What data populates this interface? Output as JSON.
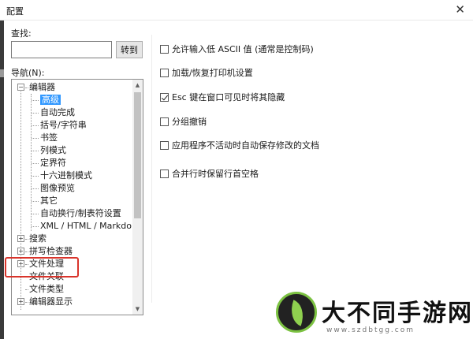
{
  "window": {
    "title": "配置",
    "close_glyph": "✕"
  },
  "search": {
    "label": "查找:",
    "value": "",
    "placeholder": "",
    "goto_label": "转到"
  },
  "navigation": {
    "label": "导航(N):",
    "tree": [
      {
        "label": "编辑器",
        "level": 0,
        "expander": "−"
      },
      {
        "label": "高级",
        "level": 1,
        "selected": true
      },
      {
        "label": "自动完成",
        "level": 1
      },
      {
        "label": "括号/字符串",
        "level": 1
      },
      {
        "label": "书签",
        "level": 1
      },
      {
        "label": "列模式",
        "level": 1
      },
      {
        "label": "定界符",
        "level": 1
      },
      {
        "label": "十六进制模式",
        "level": 1
      },
      {
        "label": "图像预览",
        "level": 1
      },
      {
        "label": "其它",
        "level": 1
      },
      {
        "label": "自动换行/制表符设置",
        "level": 1
      },
      {
        "label": "XML / HTML / Markdow",
        "level": 1
      },
      {
        "label": "搜索",
        "level": 0,
        "expander": "+"
      },
      {
        "label": "拼写检查器",
        "level": 0,
        "expander": "+"
      },
      {
        "label": "文件处理",
        "level": 0,
        "expander": "+"
      },
      {
        "label": "文件关联",
        "level": 0
      },
      {
        "label": "文件类型",
        "level": 0
      },
      {
        "label": "编辑器显示",
        "level": 0,
        "expander": "+"
      }
    ]
  },
  "options": [
    {
      "label": "允许输入低 ASCII 值 (通常是控制码)",
      "checked": false
    },
    {
      "label": "加载/恢复打印机设置",
      "checked": false
    },
    {
      "label": "Esc 键在窗口可见时将其隐藏",
      "checked": true
    },
    {
      "label": "分组撤销",
      "checked": false
    },
    {
      "label": "应用程序不活动时自动保存修改的文档",
      "checked": false
    },
    {
      "label": "合并行时保留行首空格",
      "checked": false
    }
  ],
  "watermark": {
    "title": "大不同手游网",
    "url": "www.szdbtgg.com"
  },
  "colors": {
    "selection": "#3399ff",
    "highlight_box": "#d9342b",
    "brand_green": "#7cc242"
  }
}
